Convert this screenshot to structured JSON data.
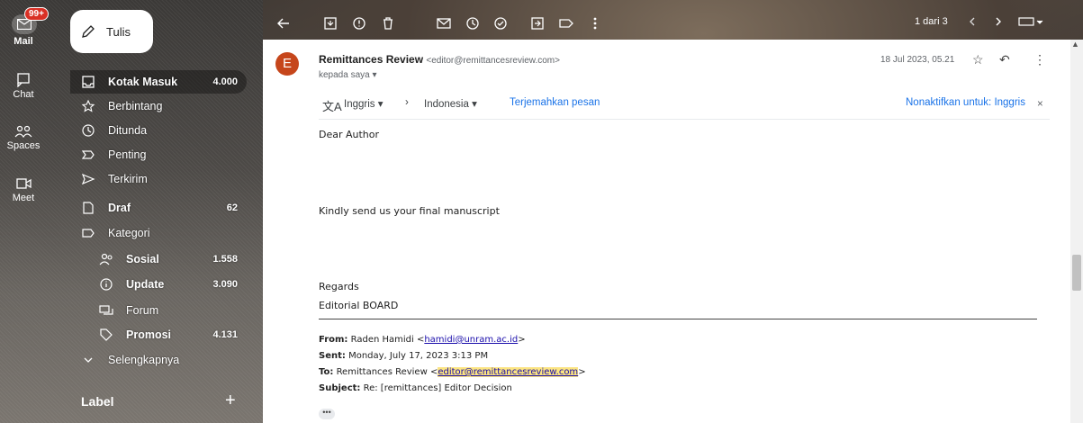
{
  "rail": {
    "mail_badge": "99+",
    "mail_label": "Mail",
    "chat_label": "Chat",
    "spaces_label": "Spaces",
    "meet_label": "Meet"
  },
  "compose": {
    "label": "Tulis"
  },
  "nav": {
    "inbox": {
      "label": "Kotak Masuk",
      "count": "4.000"
    },
    "starred": {
      "label": "Berbintang"
    },
    "snoozed": {
      "label": "Ditunda"
    },
    "important": {
      "label": "Penting"
    },
    "sent": {
      "label": "Terkirim"
    },
    "drafts": {
      "label": "Draf",
      "count": "62"
    },
    "categories": {
      "label": "Kategori"
    },
    "social": {
      "label": "Sosial",
      "count": "1.558"
    },
    "updates": {
      "label": "Update",
      "count": "3.090"
    },
    "forums": {
      "label": "Forum"
    },
    "promotions": {
      "label": "Promosi",
      "count": "4.131"
    },
    "more": {
      "label": "Selengkapnya"
    }
  },
  "labels": {
    "header": "Label",
    "add": "+"
  },
  "toolbar": {
    "pager": "1 dari 3"
  },
  "message": {
    "avatar_letter": "E",
    "sender_name": "Remittances Review",
    "sender_email": "<editor@remittancesreview.com>",
    "to_me": "kepada saya",
    "date": "18 Jul 2023, 05.21",
    "translate": {
      "from_lang": "Inggris",
      "to_lang": "Indonesia",
      "translate_link": "Terjemahkan pesan",
      "disable_link": "Nonaktifkan untuk: Inggris"
    },
    "body": {
      "greeting": "Dear Author",
      "request": "Kindly send us your final manuscript",
      "closing": "Regards",
      "signature": "Editorial BOARD"
    },
    "quoted": {
      "from_label": "From:",
      "from_name": "Raden Hamidi <",
      "from_email": "hamidi@unram.ac.id",
      "from_end": ">",
      "sent_label": "Sent:",
      "sent_value": "Monday, July 17, 2023 3:13 PM",
      "to_label": "To:",
      "to_name": "Remittances Review <",
      "to_email": "editor@remittancesreview.com",
      "to_end": ">",
      "subject_label": "Subject:",
      "subject_value": "Re: [remittances] Editor Decision"
    },
    "ellipsis": "•••"
  },
  "colors": {
    "avatar": "#c6461b",
    "badge": "#d93025",
    "link_blue": "#1a73e8",
    "highlight": "#fbe481"
  }
}
